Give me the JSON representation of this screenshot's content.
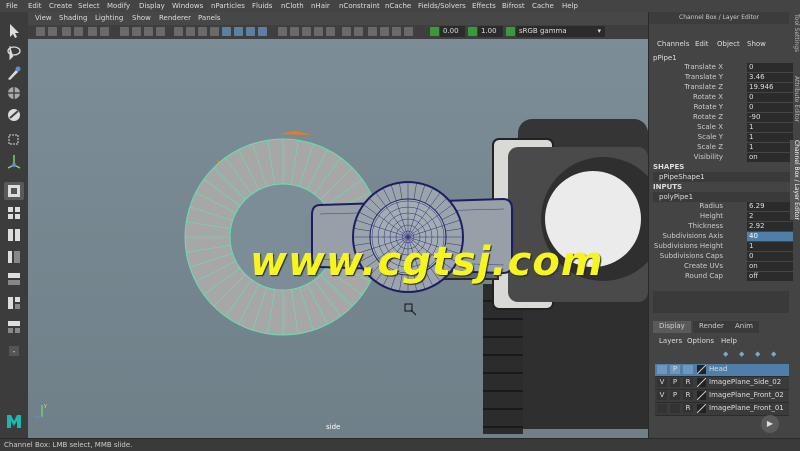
{
  "menubar": {
    "items": [
      "File",
      "Edit",
      "Create",
      "Select",
      "Modify",
      "Display",
      "Windows",
      "nParticles",
      "Fluids",
      "nCloth",
      "nHair",
      "nConstraint",
      "nCache",
      "Fields/Solvers",
      "Effects",
      "Bifrost",
      "Cache",
      "Help"
    ]
  },
  "viewport_menu": {
    "items": [
      "View",
      "Shading",
      "Lighting",
      "Show",
      "Renderer",
      "Panels"
    ]
  },
  "viewport_toolbar": {
    "field_1": "0.00",
    "field_2": "1.00",
    "color_space": "sRGB gamma"
  },
  "viewport": {
    "camera_label": "side",
    "watermark": "www.cgtsj.com"
  },
  "right_panel": {
    "header": "Channel Box / Layer Editor",
    "menu": [
      "Channels",
      "Edit",
      "Object",
      "Show"
    ],
    "object_name": "pPipe1",
    "channels": [
      {
        "label": "Translate X",
        "value": "0"
      },
      {
        "label": "Translate Y",
        "value": "3.46"
      },
      {
        "label": "Translate Z",
        "value": "19.946"
      },
      {
        "label": "Rotate X",
        "value": "0"
      },
      {
        "label": "Rotate Y",
        "value": "0"
      },
      {
        "label": "Rotate Z",
        "value": "-90"
      },
      {
        "label": "Scale X",
        "value": "1"
      },
      {
        "label": "Scale Y",
        "value": "1"
      },
      {
        "label": "Scale Z",
        "value": "1"
      },
      {
        "label": "Visibility",
        "value": "on"
      }
    ],
    "shapes_title": "SHAPES",
    "shape_node": "pPipeShape1",
    "inputs_title": "INPUTS",
    "input_node": "polyPipe1",
    "inputs": [
      {
        "label": "Radius",
        "value": "6.29"
      },
      {
        "label": "Height",
        "value": "2"
      },
      {
        "label": "Thickness",
        "value": "2.92"
      },
      {
        "label": "Subdivisions Axis",
        "value": "40"
      },
      {
        "label": "Subdivisions Height",
        "value": "1"
      },
      {
        "label": "Subdivisions Caps",
        "value": "0"
      },
      {
        "label": "Create UVs",
        "value": "on"
      },
      {
        "label": "Round Cap",
        "value": "off"
      }
    ],
    "side_tabs": [
      "Tool Settings",
      "Attribute Editor",
      "Channel Box / Layer Editor"
    ],
    "layer_tabs": [
      "Display",
      "Render",
      "Anim"
    ],
    "layer_menu": [
      "Layers",
      "Options",
      "Help"
    ],
    "layers": [
      {
        "v": "",
        "p": "P",
        "r": "",
        "name": "Head",
        "selected": true
      },
      {
        "v": "V",
        "p": "P",
        "r": "R",
        "name": "ImagePlane_Side_02",
        "selected": false
      },
      {
        "v": "V",
        "p": "P",
        "r": "R",
        "name": "ImagePlane_Front_02",
        "selected": false
      },
      {
        "v": "",
        "p": "",
        "r": "R",
        "name": "ImagePlane_Front_01",
        "selected": false
      }
    ]
  },
  "status_bar": {
    "text": "Channel Box: LMB select, MMB slide."
  },
  "colors": {
    "selection_blue": "#4f7fa8",
    "highlight_green": "#5fe3b0",
    "orange": "#f07a1a",
    "watermark_yellow": "#f6f51e"
  }
}
